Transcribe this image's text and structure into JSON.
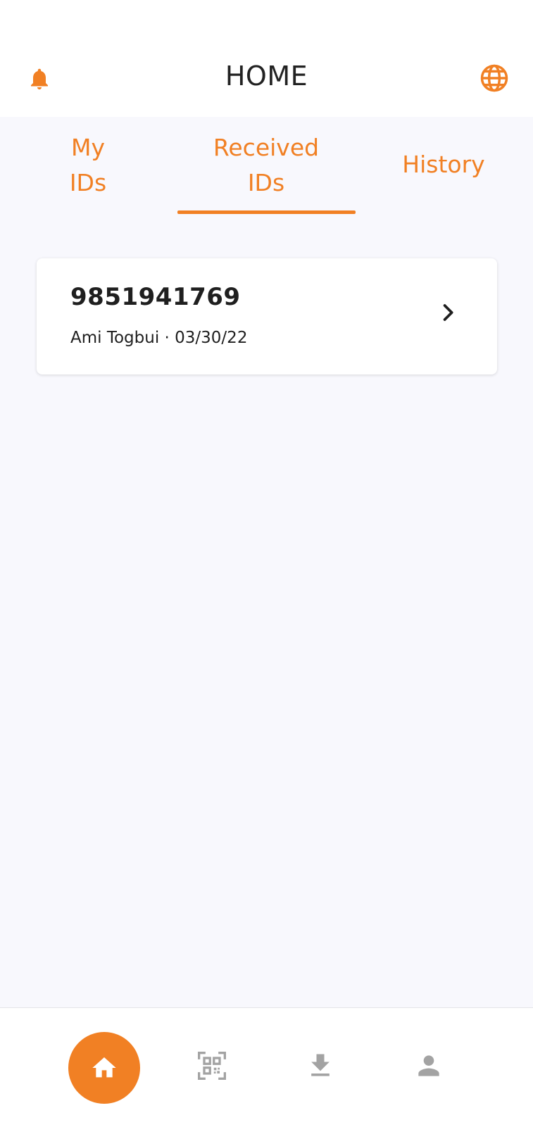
{
  "header": {
    "title": "HOME",
    "bell_icon": "bell-icon",
    "language_icon": "globe-icon"
  },
  "tabs": [
    {
      "label_line1": "My",
      "label_line2": "IDs",
      "active": false
    },
    {
      "label_line1": "Received",
      "label_line2": "IDs",
      "active": true
    },
    {
      "label_line1": "History",
      "active": false
    }
  ],
  "received_ids": [
    {
      "id_number": "9851941769",
      "subtitle": "Ami Togbui · 03/30/22"
    }
  ],
  "bottom_nav": [
    {
      "icon": "home-icon",
      "active": true
    },
    {
      "icon": "qr-code-icon",
      "active": false
    },
    {
      "icon": "download-icon",
      "active": false
    },
    {
      "icon": "person-icon",
      "active": false
    }
  ],
  "colors": {
    "accent": "#f18024",
    "background": "#f8f8fd",
    "inactive_icon": "#a3a3a3",
    "text_dark": "#1f1f1f"
  }
}
